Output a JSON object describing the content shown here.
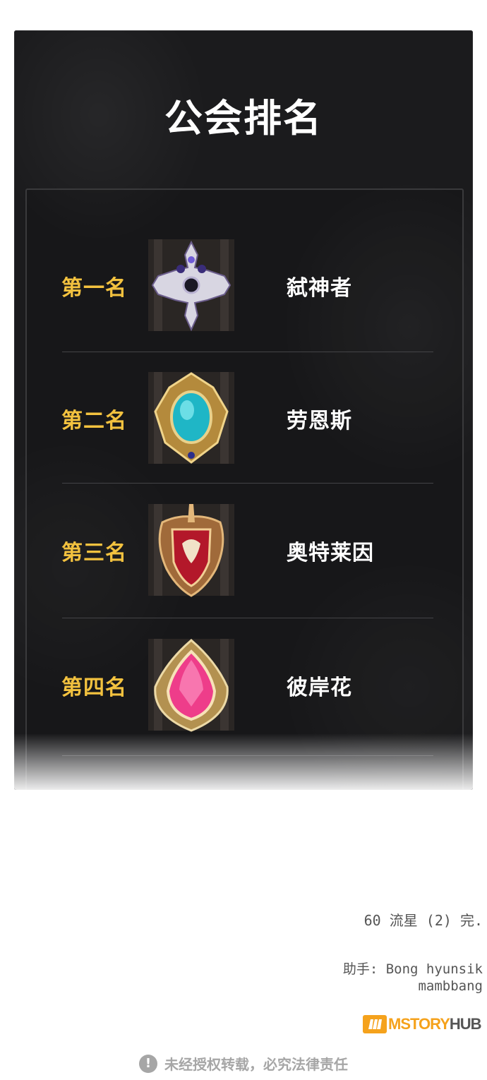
{
  "panel": {
    "title": "公会排名",
    "rankings": [
      {
        "rank": "第一名",
        "guild": "弑神者",
        "emblem": "cross-emblem-icon"
      },
      {
        "rank": "第二名",
        "guild": "劳恩斯",
        "emblem": "blue-gem-emblem-icon"
      },
      {
        "rank": "第三名",
        "guild": "奥特莱因",
        "emblem": "lion-shield-emblem-icon"
      },
      {
        "rank": "第四名",
        "guild": "彼岸花",
        "emblem": "pink-gem-emblem-icon"
      }
    ]
  },
  "footer": {
    "chapter": "60 流星 (2) 完.",
    "assistant_line1": "助手: Bong hyunsik",
    "assistant_line2": "mambbang",
    "logo_main": "MSTORY",
    "logo_suffix": "HUB",
    "warning": "未经授权转载，必究法律责任"
  },
  "colors": {
    "rank_gold": "#f3c23f",
    "panel_bg": "#1b1b1d",
    "logo_orange": "#f5a21c"
  }
}
